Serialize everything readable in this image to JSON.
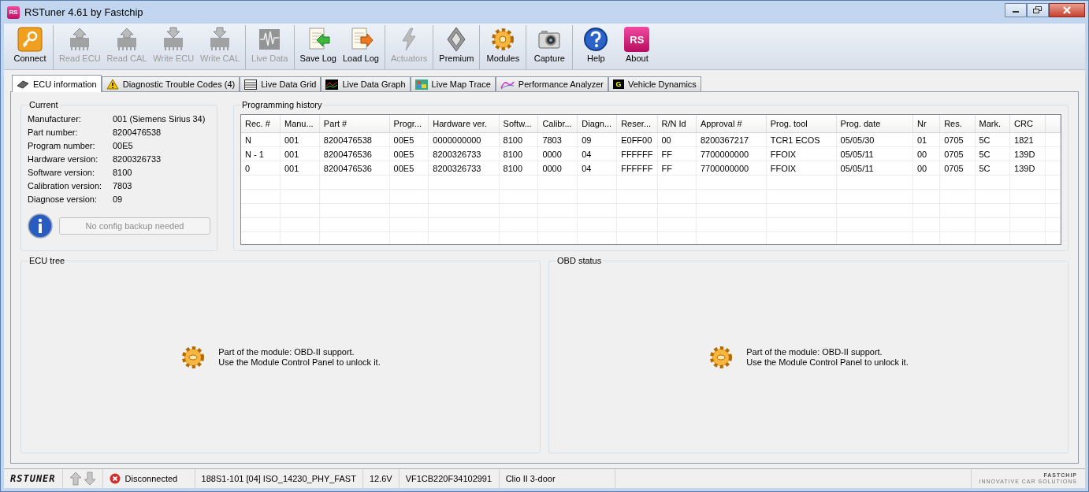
{
  "window": {
    "title": "RSTuner 4.61 by Fastchip",
    "app_icon_text": "RS"
  },
  "toolbar": [
    {
      "items": [
        {
          "label": "Connect",
          "kind": "key",
          "disabled": false
        }
      ]
    },
    {
      "items": [
        {
          "label": "Read ECU",
          "kind": "chip-up",
          "disabled": true
        },
        {
          "label": "Read CAL",
          "kind": "chip-up",
          "disabled": true
        },
        {
          "label": "Write ECU",
          "kind": "chip-down",
          "disabled": true
        },
        {
          "label": "Write CAL",
          "kind": "chip-down",
          "disabled": true
        }
      ]
    },
    {
      "items": [
        {
          "label": "Live Data",
          "kind": "wave",
          "disabled": true
        }
      ]
    },
    {
      "items": [
        {
          "label": "Save Log",
          "kind": "log-in",
          "disabled": false
        },
        {
          "label": "Load Log",
          "kind": "log-out",
          "disabled": false
        }
      ]
    },
    {
      "items": [
        {
          "label": "Actuators",
          "kind": "bolt",
          "disabled": true
        }
      ]
    },
    {
      "items": [
        {
          "label": "Premium",
          "kind": "diamond",
          "disabled": false
        }
      ]
    },
    {
      "items": [
        {
          "label": "Modules",
          "kind": "gear",
          "disabled": false
        }
      ]
    },
    {
      "items": [
        {
          "label": "Capture",
          "kind": "camera",
          "disabled": false
        }
      ]
    },
    {
      "items": [
        {
          "label": "Help",
          "kind": "help",
          "disabled": false
        },
        {
          "label": "About",
          "kind": "logo",
          "disabled": false,
          "icon_text": "RS"
        }
      ]
    }
  ],
  "tabs": [
    {
      "label": "ECU information",
      "kind": "chip",
      "selected": true
    },
    {
      "label": "Diagnostic Trouble Codes (4)",
      "kind": "warning",
      "selected": false
    },
    {
      "label": "Live Data Grid",
      "kind": "grid",
      "selected": false
    },
    {
      "label": "Live Data Graph",
      "kind": "graph",
      "selected": false
    },
    {
      "label": "Live Map Trace",
      "kind": "map",
      "selected": false
    },
    {
      "label": "Performance Analyzer",
      "kind": "curve",
      "selected": false
    },
    {
      "label": "Vehicle Dynamics",
      "kind": "dynamics",
      "selected": false,
      "icon_text": "G"
    }
  ],
  "current": {
    "title": "Current",
    "fields": [
      {
        "label": "Manufacturer:",
        "value": "001 (Siemens Sirius 34)"
      },
      {
        "label": "Part number:",
        "value": "8200476538"
      },
      {
        "label": "Program number:",
        "value": "00E5"
      },
      {
        "label": "Hardware version:",
        "value": "8200326733"
      },
      {
        "label": "Software version:",
        "value": "8100"
      },
      {
        "label": "Calibration version:",
        "value": "7803"
      },
      {
        "label": "Diagnose version:",
        "value": "09"
      }
    ],
    "backup_button": {
      "label": "No config backup needed",
      "disabled": true
    }
  },
  "programming_history": {
    "title": "Programming history",
    "columns": [
      "Rec. #",
      "Manu...",
      "Part #",
      "Progr...",
      "Hardware ver.",
      "Softw...",
      "Calibr...",
      "Diagn...",
      "Reser...",
      "R/N Id",
      "Approval #",
      "Prog. tool",
      "Prog. date",
      "Nr",
      "Res.",
      "Mark.",
      "CRC"
    ],
    "rows": [
      [
        "N",
        "001",
        "8200476538",
        "00E5",
        "0000000000",
        "8100",
        "7803",
        "09",
        "E0FF00",
        "00",
        "8200367217",
        "TCR1 ECOS",
        "05/05/30",
        "01",
        "0705",
        "5C",
        "1821"
      ],
      [
        "N - 1",
        "001",
        "8200476536",
        "00E5",
        "8200326733",
        "8100",
        "0000",
        "04",
        "FFFFFF",
        "FF",
        "7700000000",
        "FFOIX",
        "05/05/11",
        "00",
        "0705",
        "5C",
        "139D"
      ],
      [
        "0",
        "001",
        "8200476536",
        "00E5",
        "8200326733",
        "8100",
        "0000",
        "04",
        "FFFFFF",
        "FF",
        "7700000000",
        "FFOIX",
        "05/05/11",
        "00",
        "0705",
        "5C",
        "139D"
      ]
    ]
  },
  "ecu_tree": {
    "title": "ECU tree",
    "message": [
      "Part of the module: OBD-II support.",
      "Use the Module Control Panel to unlock it."
    ]
  },
  "obd_status": {
    "title": "OBD status",
    "message": [
      "Part of the module: OBD-II support.",
      "Use the Module Control Panel to unlock it."
    ]
  },
  "status_bar": {
    "logo": "RSTUNER",
    "connection": "Disconnected",
    "protocol": "188S1-101 [04] ISO_14230_PHY_FAST",
    "voltage": "12.6V",
    "vin": "VF1CB220F34102991",
    "vehicle": "Clio II 3-door",
    "brand": "FASTCHIP",
    "tagline": "INNOVATIVE CAR SOLUTIONS"
  }
}
